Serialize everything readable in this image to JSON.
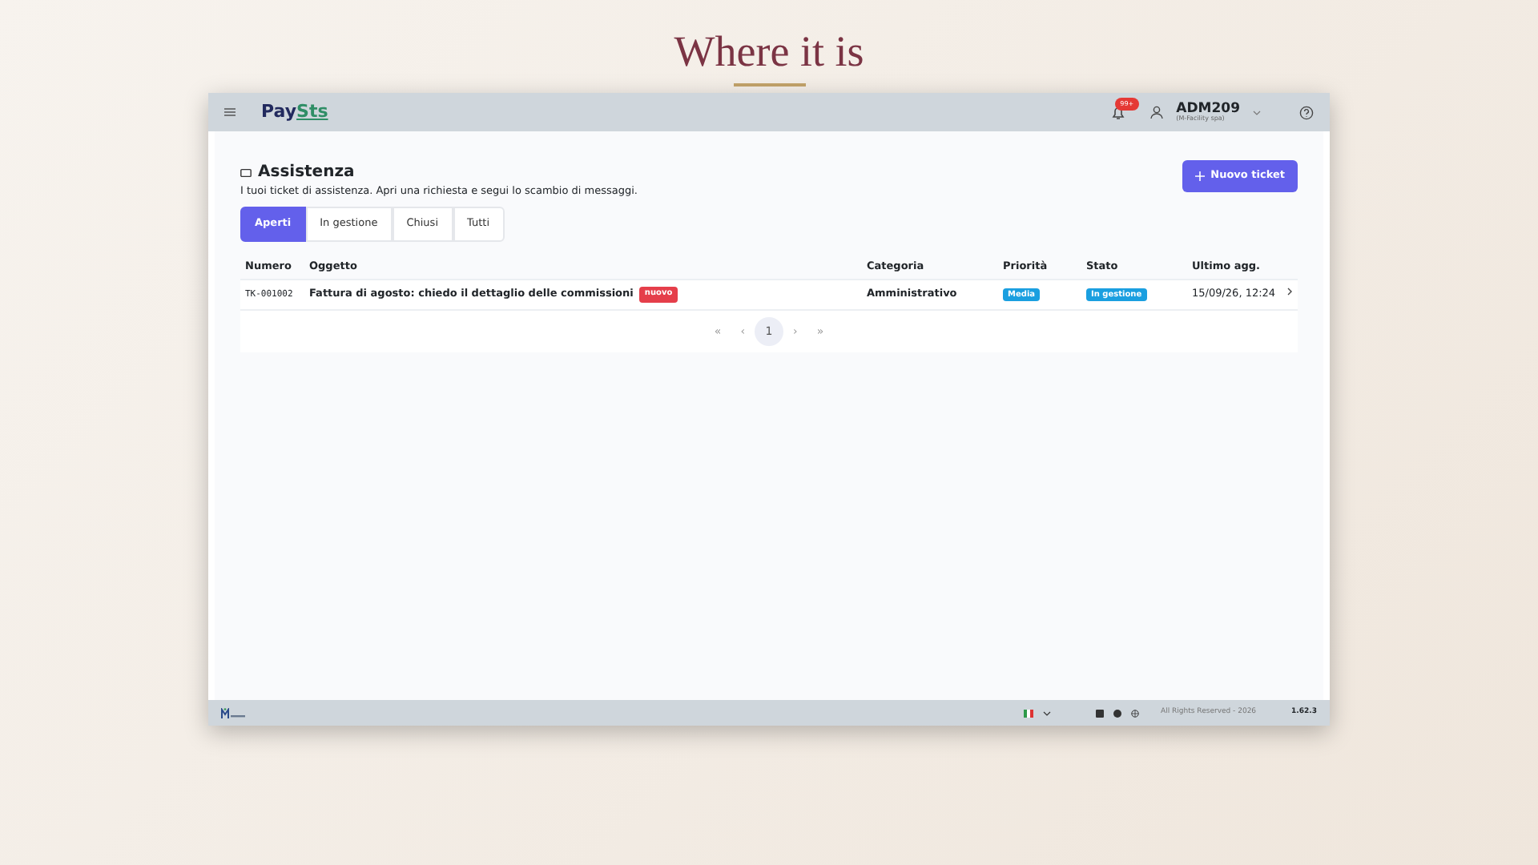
{
  "slide_title": "Where it is",
  "header": {
    "logo": [
      "Pay",
      "Sts"
    ],
    "notifications_badge": "99+",
    "user": "ADM209",
    "company": "(M-Facility spa)"
  },
  "page": {
    "title": "Assistenza",
    "subtitle": "I tuoi ticket di assistenza. Apri una richiesta e segui lo scambio di messaggi.",
    "new_button": "Nuovo ticket"
  },
  "tabs": [
    {
      "label": "Aperti",
      "selected": true
    },
    {
      "label": "In gestione",
      "selected": false
    },
    {
      "label": "Chiusi",
      "selected": false
    },
    {
      "label": "Tutti",
      "selected": false
    }
  ],
  "table": {
    "columns": [
      "Numero",
      "Oggetto",
      "Categoria",
      "Priorità",
      "Stato",
      "Ultimo agg."
    ],
    "rows": [
      {
        "number": "TK-001002",
        "subject": "Fattura di agosto: chiedo il dettaglio delle commissioni",
        "tag": "nuovo",
        "category": "Amministrativo",
        "priority": "Media",
        "status": "In gestione",
        "updated": "15/09/26, 12:24"
      }
    ]
  },
  "pagination": {
    "first": "«",
    "prev": "‹",
    "pages": [
      {
        "label": "1",
        "selected": true
      }
    ],
    "next": "›",
    "last": "»"
  },
  "footer": {
    "copyright": "All Rights Reserved - 2026",
    "version": "1.62.3"
  }
}
